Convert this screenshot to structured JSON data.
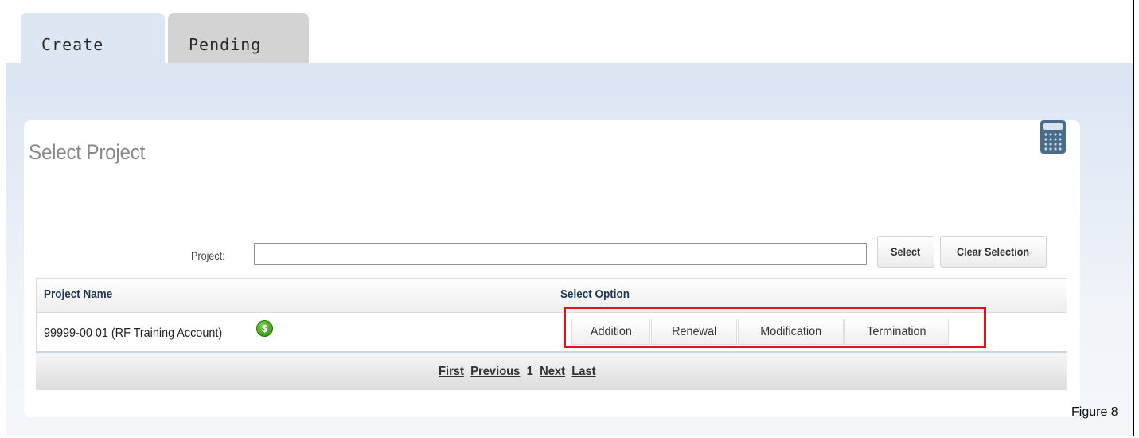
{
  "tabs": [
    {
      "label": "Create"
    },
    {
      "label": "Pending"
    }
  ],
  "panel": {
    "title": "Select Project",
    "calculator_icon": "calculator-icon"
  },
  "search": {
    "label": "Project:",
    "value": "",
    "select_label": "Select",
    "clear_label": "Clear Selection"
  },
  "table": {
    "headers": [
      "Project Name",
      "Select Option"
    ],
    "rows": [
      {
        "name": "99999-00 01 (RF Training Account)",
        "status_icon": "dollar-icon",
        "options": [
          "Addition",
          "Renewal",
          "Modification",
          "Termination"
        ]
      }
    ]
  },
  "pager": {
    "first": "First",
    "previous": "Previous",
    "current": "1",
    "next": "Next",
    "last": "Last"
  },
  "figure_label": "Figure 8",
  "colors": {
    "highlight": "#e0141b",
    "tab_active": "#dde7f4",
    "tab_inactive": "#d4d3d3",
    "header_text": "#1f3550",
    "status_icon": "#3f9a1e"
  }
}
